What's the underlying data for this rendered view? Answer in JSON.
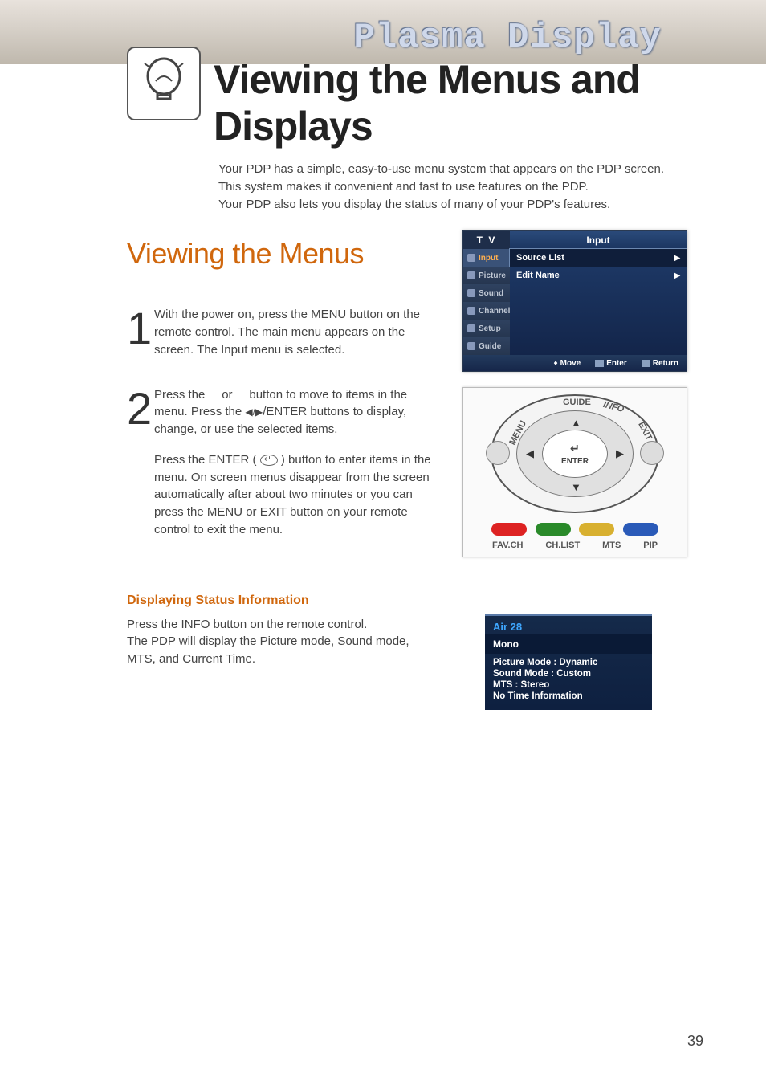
{
  "banner": {
    "product_line": "Plasma Display"
  },
  "page": {
    "title": "Viewing the Menus and Displays",
    "intro_l1": "Your PDP has a simple, easy-to-use menu system that appears on the PDP screen.",
    "intro_l2": "This system makes it convenient and fast to use features on the PDP.",
    "intro_l3": "Your PDP also lets you display the status of many of your PDP's features.",
    "number": "39"
  },
  "section": {
    "title": "Viewing the Menus"
  },
  "steps": {
    "s1": {
      "num": "1",
      "text": "With the power on, press the MENU button on the remote control. The main menu appears on the screen. The Input menu is selected."
    },
    "s2": {
      "num": "2",
      "p1a": "Press the     or     button to move to items in the menu. Press the ",
      "p1_arrows": "◀/▶",
      "p1b": "/ENTER buttons to display, change, or use the selected items.",
      "p2a": "Press the ENTER ( ",
      "p2b": " ) button to enter items in the menu. On screen menus disappear from the screen automatically after about two minutes or you can press the MENU or EXIT button on your remote control to exit the menu."
    }
  },
  "osd": {
    "tv": "T V",
    "title": "Input",
    "side": [
      "Input",
      "Picture",
      "Sound",
      "Channel",
      "Setup",
      "Guide"
    ],
    "rows": [
      "Source List",
      "Edit Name"
    ],
    "footer": {
      "move": "Move",
      "enter": "Enter",
      "return": "Return"
    }
  },
  "remote": {
    "guide": "GUIDE",
    "info": "INFO",
    "menu": "MENU",
    "exit": "EXIT",
    "enter": "ENTER",
    "bottom": [
      "FAV.CH",
      "CH.LIST",
      "MTS",
      "PIP"
    ]
  },
  "status_section": {
    "heading": "Displaying Status Information",
    "l1": "Press the INFO button on the remote control.",
    "l2": "The PDP will display the Picture mode, Sound mode,",
    "l3": "MTS, and Current Time."
  },
  "status_box": {
    "channel": "Air 28",
    "mono": "Mono",
    "lines": [
      "Picture Mode : Dynamic",
      "Sound Mode : Custom",
      "MTS : Stereo",
      "No Time Information"
    ]
  }
}
